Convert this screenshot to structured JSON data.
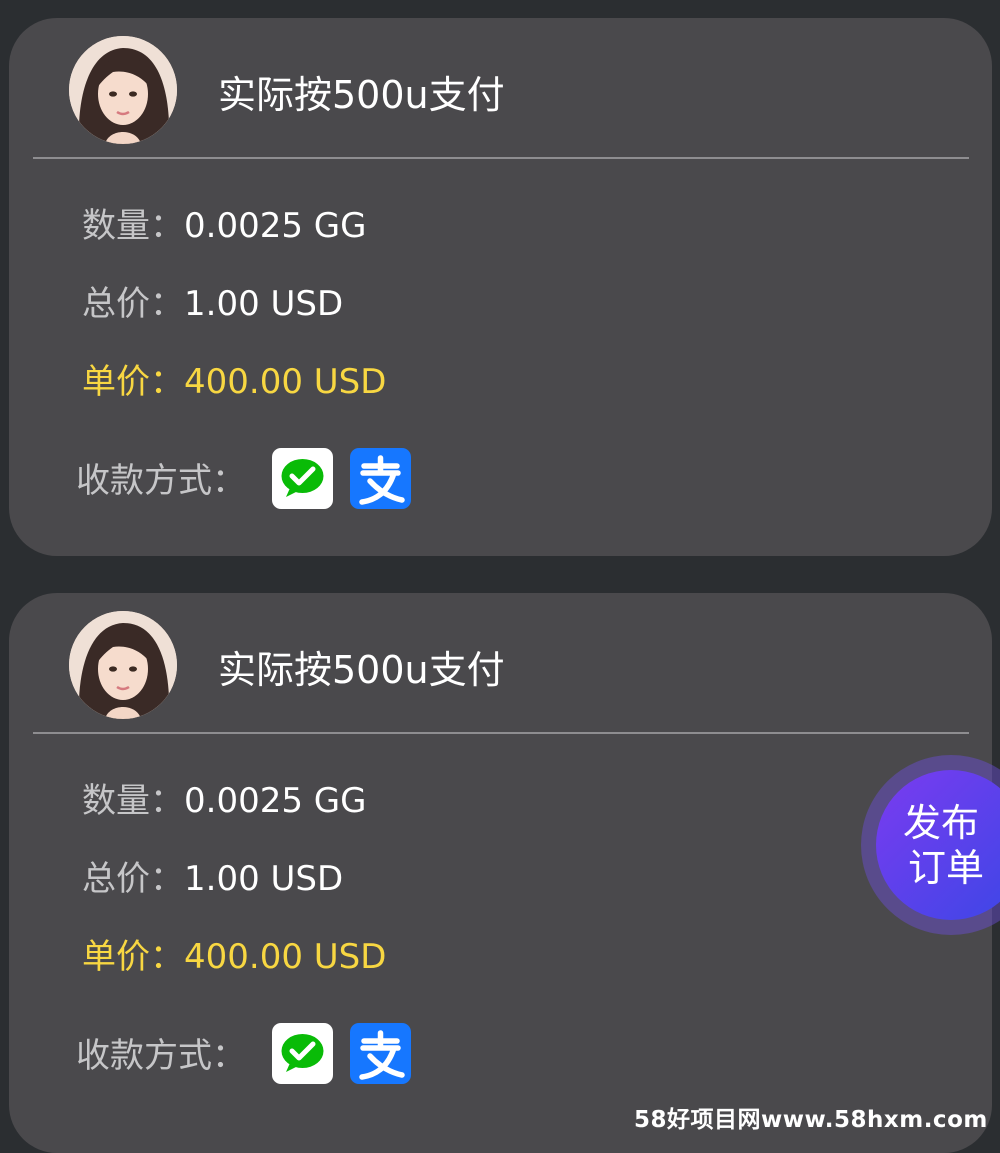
{
  "orders": [
    {
      "title": "实际按500u支付",
      "quantity_label": "数量：",
      "quantity_value": "0.0025 GG",
      "total_label": "总价：",
      "total_value": "1.00 USD",
      "price_label": "单价：",
      "price_value": "400.00 USD",
      "payment_label": "收款方式：",
      "payment_methods": [
        "wechat-pay-icon",
        "alipay-icon"
      ]
    },
    {
      "title": "实际按500u支付",
      "quantity_label": "数量：",
      "quantity_value": "0.0025 GG",
      "total_label": "总价：",
      "total_value": "1.00 USD",
      "price_label": "单价：",
      "price_value": "400.00 USD",
      "payment_label": "收款方式：",
      "payment_methods": [
        "wechat-pay-icon",
        "alipay-icon"
      ]
    }
  ],
  "fab": {
    "line1": "发布",
    "line2": "订单"
  },
  "watermark": "58好项目网www.58hxm.com",
  "colors": {
    "background": "#2b2e31",
    "card": "#4a494c",
    "price_highlight": "#f8d742",
    "wechat_green": "#09bb07",
    "alipay_blue": "#1677ff",
    "fab_gradient_start": "#7b3bf0",
    "fab_gradient_end": "#3b47e6"
  }
}
